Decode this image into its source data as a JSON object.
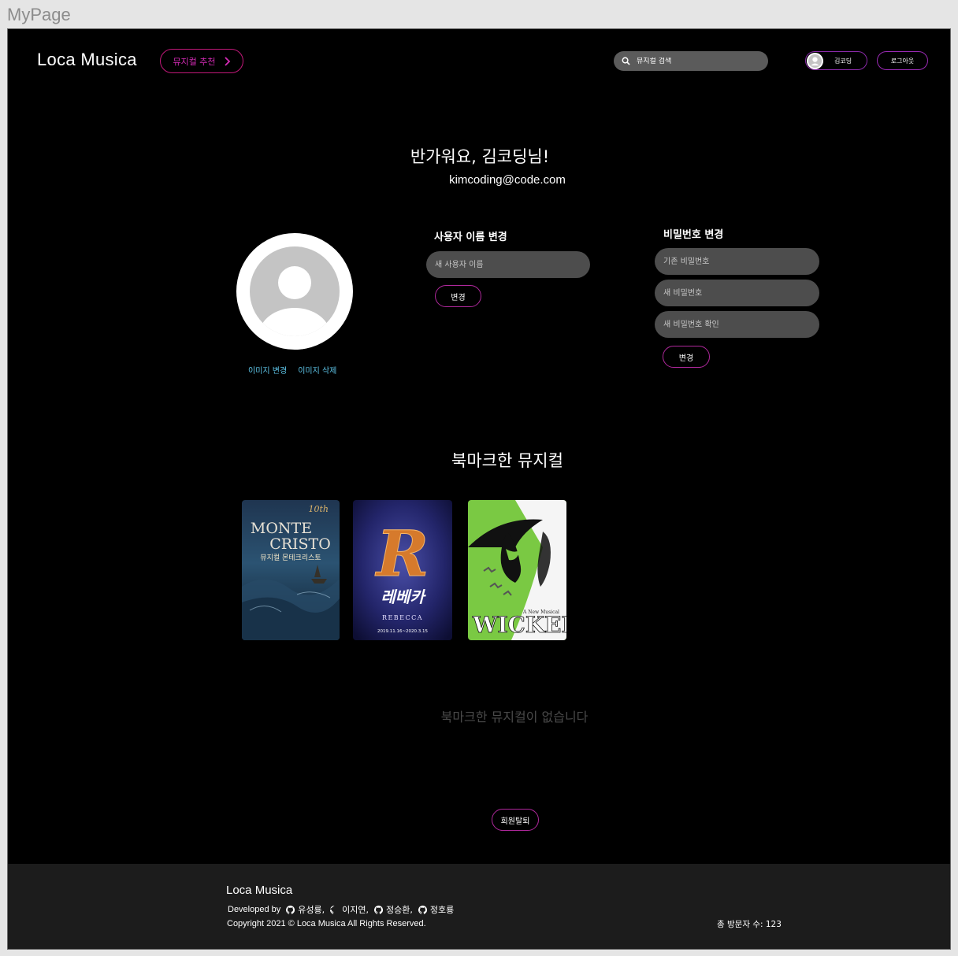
{
  "frame_label": "MyPage",
  "header": {
    "logo": "Loca Musica",
    "recommend_label": "뮤지컬 추천",
    "search_placeholder": "뮤지컬 검색",
    "user_name": "김코딩",
    "logout_label": "로그아웃"
  },
  "profile": {
    "greeting": "반가워요, 김코딩님!",
    "email": "kimcoding@code.com",
    "change_image": "이미지 변경",
    "delete_image": "이미지 삭제"
  },
  "username_section": {
    "title": "사용자 이름 변경",
    "placeholder": "새 사용자 이름",
    "button": "변경"
  },
  "password_section": {
    "title": "비밀번호 변경",
    "current_placeholder": "기존 비밀번호",
    "new_placeholder": "새 비밀번호",
    "confirm_placeholder": "새 비밀번호 확인",
    "button": "변경"
  },
  "bookmarks": {
    "title": "북마크한 뮤지컬",
    "empty_message": "북마크한 뮤지컬이 없습니다",
    "posters": [
      {
        "line1": "MONTE",
        "line2": "CRISTO",
        "sub": "뮤지컬 몬테크리스토",
        "badge": "10th"
      },
      {
        "letter": "R",
        "title": "레베카",
        "sub": "REBECCA",
        "date": "2019.11.16~2020.3.15"
      },
      {
        "title": "WICKED",
        "sub": "A New Musical"
      }
    ]
  },
  "withdraw_label": "회원탈퇴",
  "footer": {
    "logo": "Loca Musica",
    "developed_by": "Developed by",
    "developers": [
      "유성룡,",
      "이지연,",
      "정승환,",
      "정호룡"
    ],
    "copyright": "Copyright 2021 © Loca Musica All Rights Reserved.",
    "visitors": "총 방문자 수: 123"
  },
  "colors": {
    "accent_pink": "#c2187a",
    "accent_purple": "#9a2ab4",
    "link_blue": "#5ec5e8",
    "input_bg": "#4d4d4d",
    "footer_bg": "#1c1c1c"
  },
  "icons": [
    "chevron-right-icon",
    "search-icon",
    "user-avatar-icon",
    "github-icon"
  ]
}
